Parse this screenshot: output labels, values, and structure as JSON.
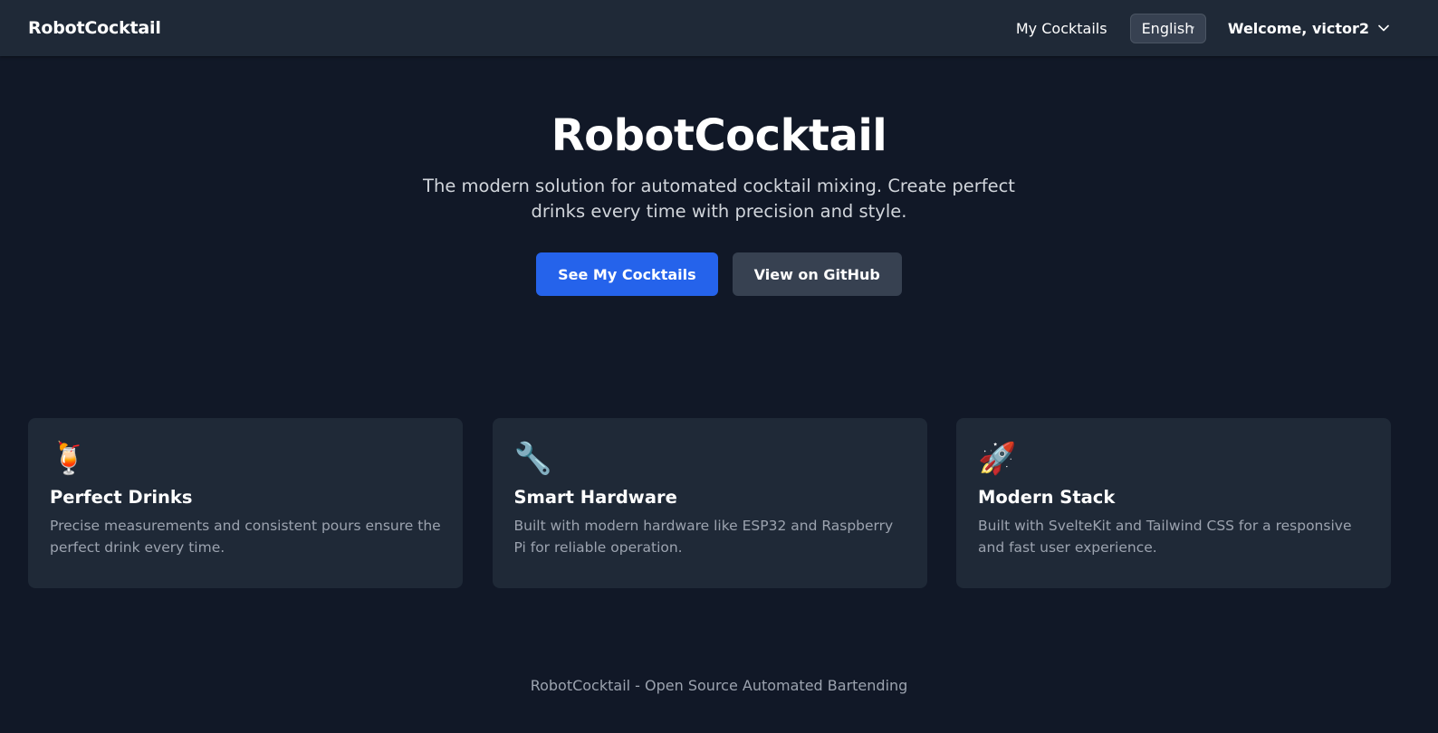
{
  "navbar": {
    "brand": "RobotCocktail",
    "my_cocktails_link": "My Cocktails",
    "language_select": {
      "selected": "English",
      "icon": "chevron-down-icon"
    },
    "user_menu": {
      "label": "Welcome, victor2",
      "icon": "chevron-down-icon"
    }
  },
  "hero": {
    "title": "RobotCocktail",
    "subtitle": "The modern solution for automated cocktail mixing. Create perfect drinks every time with precision and style.",
    "primary_button": "See My Cocktails",
    "secondary_button": "View on GitHub"
  },
  "features": [
    {
      "icon": "tropical-drink-icon",
      "glyph": "🍹",
      "title": "Perfect Drinks",
      "description": "Precise measurements and consistent pours ensure the perfect drink every time."
    },
    {
      "icon": "wrench-icon",
      "glyph": "🔧",
      "title": "Smart Hardware",
      "description": "Built with modern hardware like ESP32 and Raspberry Pi for reliable operation."
    },
    {
      "icon": "rocket-icon",
      "glyph": "🚀",
      "title": "Modern Stack",
      "description": "Built with SvelteKit and Tailwind CSS for a responsive and fast user experience."
    }
  ],
  "footer": {
    "text": "RobotCocktail - Open Source Automated Bartending"
  },
  "colors": {
    "background": "#111827",
    "surface": "#1f2937",
    "primary": "#2563eb",
    "secondary": "#374151",
    "muted_text": "#9ca3af"
  }
}
